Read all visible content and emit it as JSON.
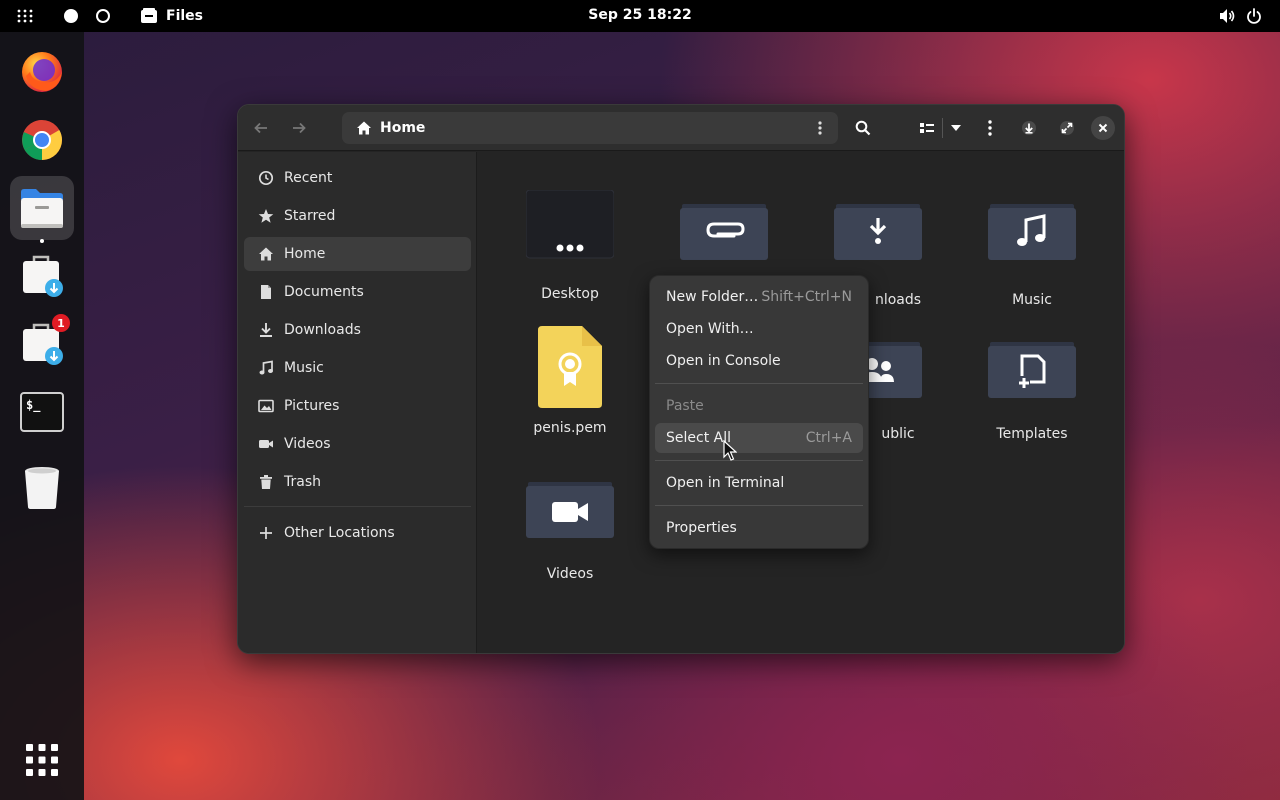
{
  "topbar": {
    "app_name": "Files",
    "clock": "Sep 25  18:22"
  },
  "dock": {
    "items": [
      "firefox-icon",
      "chrome-icon",
      "files-icon",
      "installer-icon",
      "installer-updates-icon",
      "terminal-icon",
      "trash-icon",
      "show-apps-icon"
    ],
    "update_badge": "1"
  },
  "window": {
    "path": "Home",
    "sidebar": {
      "items": [
        {
          "label": "Recent",
          "icon": "clock-icon"
        },
        {
          "label": "Starred",
          "icon": "star-icon"
        },
        {
          "label": "Home",
          "icon": "home-icon"
        },
        {
          "label": "Documents",
          "icon": "document-icon"
        },
        {
          "label": "Downloads",
          "icon": "download-icon"
        },
        {
          "label": "Music",
          "icon": "music-icon"
        },
        {
          "label": "Pictures",
          "icon": "picture-icon"
        },
        {
          "label": "Videos",
          "icon": "video-icon"
        },
        {
          "label": "Trash",
          "icon": "trash-icon"
        }
      ],
      "other_locations": "Other Locations"
    },
    "files": [
      {
        "label": "Desktop"
      },
      {
        "label": ""
      },
      {
        "label": "nloads"
      },
      {
        "label": "Music"
      },
      {
        "label": "penis.pem"
      },
      {
        "label": ""
      },
      {
        "label": "ublic"
      },
      {
        "label": "Templates"
      },
      {
        "label": "Videos"
      }
    ]
  },
  "context_menu": {
    "new_folder": "New Folder…",
    "new_folder_accel": "Shift+Ctrl+N",
    "open_with": "Open With…",
    "open_console": "Open in Console",
    "paste": "Paste",
    "select_all": "Select All",
    "select_all_accel": "Ctrl+A",
    "open_terminal": "Open in Terminal",
    "properties": "Properties"
  },
  "colors": {
    "folder": "#3d4455",
    "folder_tab": "#2f3544",
    "pem_file": "#f3d35a",
    "badge": "#e01b24"
  }
}
